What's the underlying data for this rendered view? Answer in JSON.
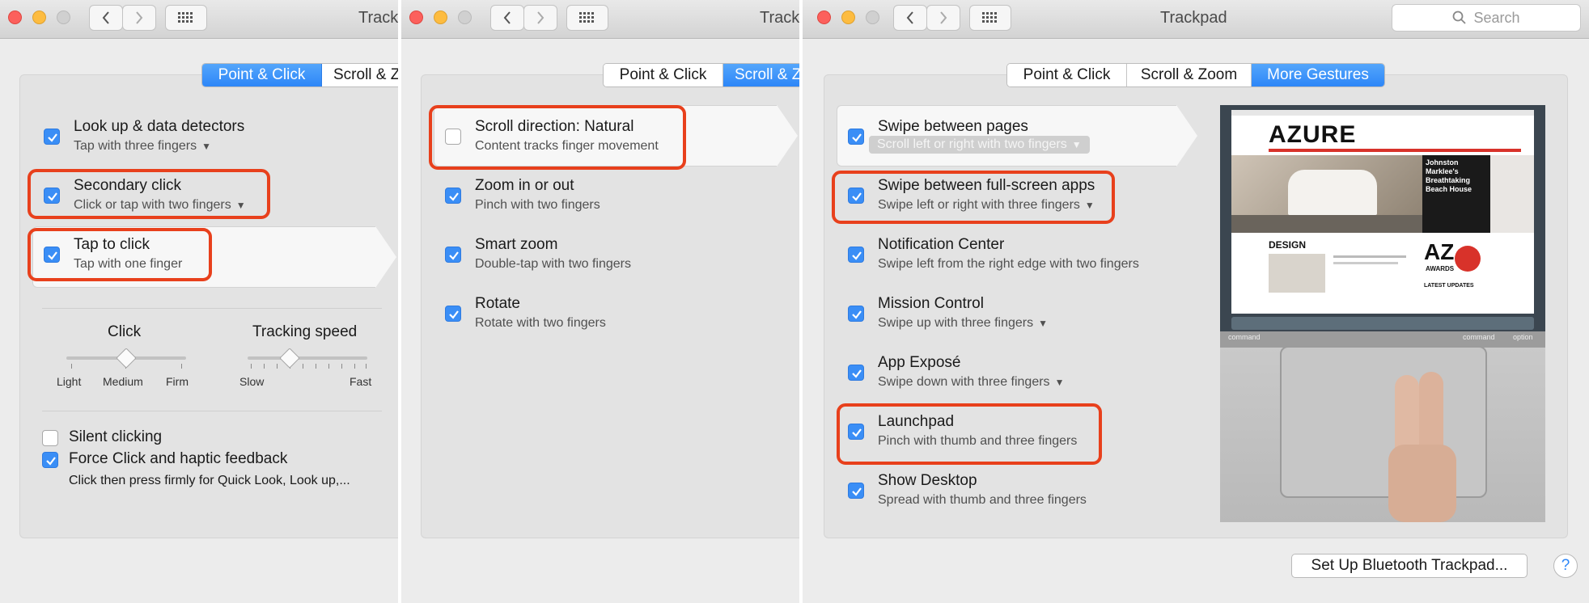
{
  "windows": {
    "p1": {
      "title": "Track"
    },
    "p2": {
      "title": "Trackp"
    },
    "p3": {
      "title": "Trackpad",
      "search_placeholder": "Search"
    }
  },
  "tabs": {
    "point_click": "Point & Click",
    "scroll_zoom": "Scroll & Zoom",
    "scroll_zoom_clipped": "Scroll & Z",
    "more_gestures": "More Gestures"
  },
  "point_click": {
    "items": [
      {
        "title": "Look up & data detectors",
        "subtitle": "Tap with three fingers",
        "checked": true
      },
      {
        "title": "Secondary click",
        "subtitle": "Click or tap with two fingers",
        "checked": true
      },
      {
        "title": "Tap to click",
        "subtitle": "Tap with one finger",
        "checked": true
      }
    ],
    "click_slider": {
      "label": "Click",
      "min_label": "Light",
      "mid_label": "Medium",
      "max_label": "Firm",
      "value": 0.5
    },
    "tracking_slider": {
      "label": "Tracking speed",
      "min_label": "Slow",
      "max_label": "Fast",
      "value": 0.35
    },
    "silent_clicking": {
      "title": "Silent clicking",
      "checked": false
    },
    "force_click": {
      "title": "Force Click and haptic feedback",
      "subtitle": "Click then press firmly for Quick Look, Look up,...",
      "checked": true
    }
  },
  "scroll_zoom": {
    "items": [
      {
        "title": "Scroll direction: Natural",
        "subtitle": "Content tracks finger movement",
        "checked": false
      },
      {
        "title": "Zoom in or out",
        "subtitle": "Pinch with two fingers",
        "checked": true
      },
      {
        "title": "Smart zoom",
        "subtitle": "Double-tap with two fingers",
        "checked": true
      },
      {
        "title": "Rotate",
        "subtitle": "Rotate with two fingers",
        "checked": true
      }
    ]
  },
  "more_gestures": {
    "items": [
      {
        "title": "Swipe between pages",
        "subtitle": "Scroll left or right with two fingers",
        "checked": true
      },
      {
        "title": "Swipe between full-screen apps",
        "subtitle": "Swipe left or right with three fingers",
        "checked": true
      },
      {
        "title": "Notification Center",
        "subtitle": "Swipe left from the right edge with two fingers",
        "checked": true
      },
      {
        "title": "Mission Control",
        "subtitle": "Swipe up with three fingers",
        "checked": true
      },
      {
        "title": "App Exposé",
        "subtitle": "Swipe down with three fingers",
        "checked": true
      },
      {
        "title": "Launchpad",
        "subtitle": "Pinch with thumb and three fingers",
        "checked": true
      },
      {
        "title": "Show Desktop",
        "subtitle": "Spread with thumb and three fingers",
        "checked": true
      }
    ],
    "preview": {
      "site_name": "AZURE",
      "headline": "Johnston Marklee's Breathtaking Beach House",
      "section": "DESIGN",
      "badge": "AZ",
      "badge_sub": "AWARDS",
      "latest": "LATEST UPDATES",
      "key_command_left": "command",
      "key_command_right": "command",
      "key_option": "option"
    }
  },
  "footer": {
    "setup_button": "Set Up Bluetooth Trackpad...",
    "help_label": "?"
  },
  "colors": {
    "accent": "#2d86f8",
    "highlight": "#e8401c",
    "checkbox": "#3a8ef6"
  }
}
